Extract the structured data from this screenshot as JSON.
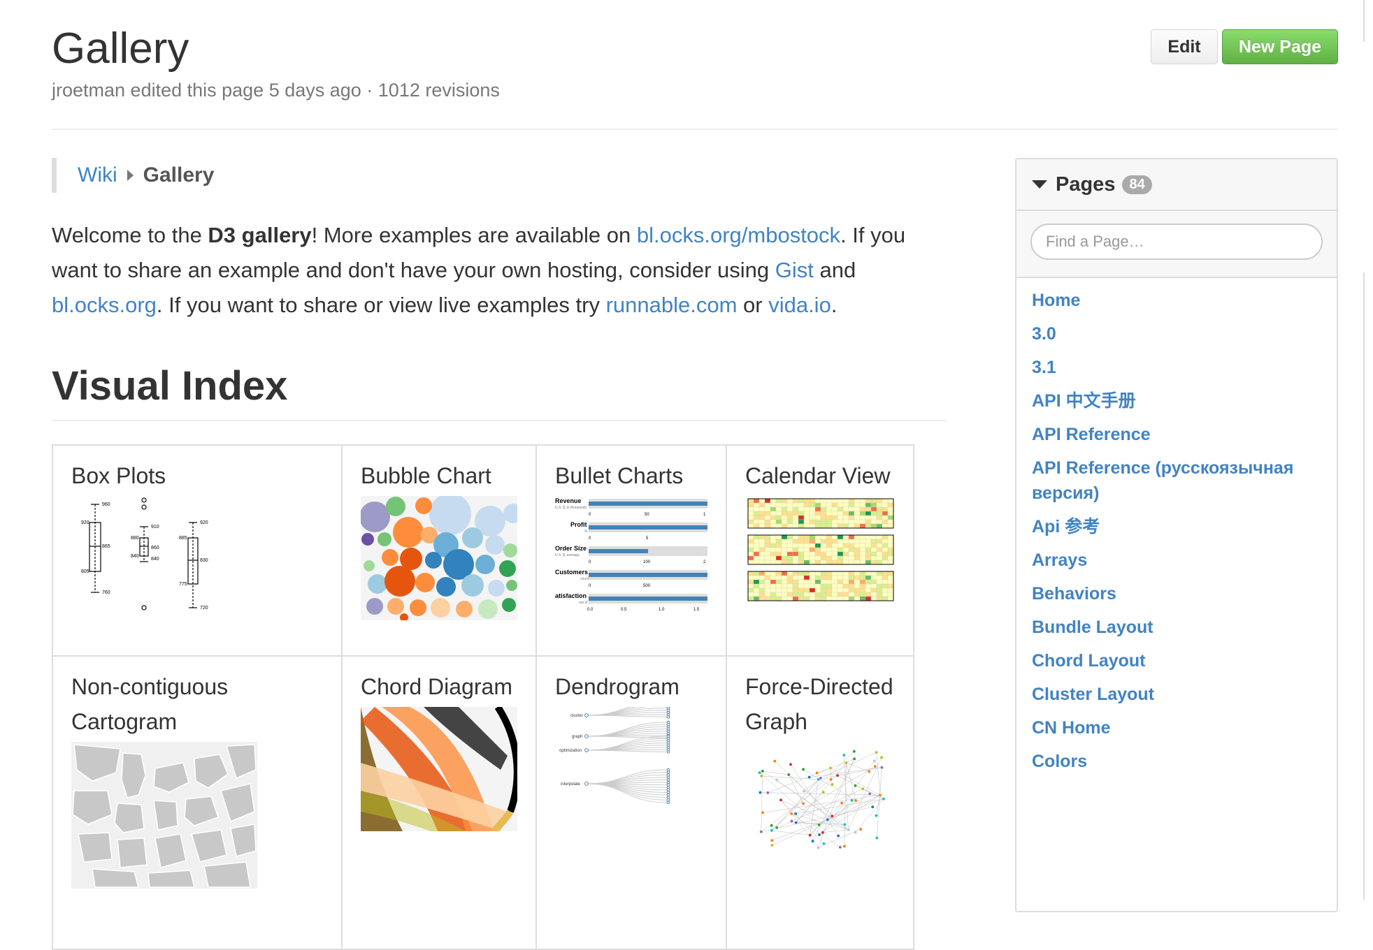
{
  "header": {
    "title": "Gallery",
    "meta": "jroetman edited this page 5 days ago · 1012 revisions",
    "edit_label": "Edit",
    "new_page_label": "New Page"
  },
  "breadcrumb": {
    "root": "Wiki",
    "current": "Gallery"
  },
  "intro": {
    "t1": "Welcome to the ",
    "bold": "D3 gallery",
    "t2": "! More examples are available on ",
    "link1": "bl.ocks.org/mbostock",
    "t3": ". If you want to share an example and don't have your own hosting, consider using ",
    "link2": "Gist",
    "t4": " and ",
    "link3": "bl.ocks.org",
    "t5": ". If you want to share or view live examples try ",
    "link4": "runnable.com",
    "t6": " or ",
    "link5": "vida.io",
    "t7": "."
  },
  "section": {
    "title": "Visual Index"
  },
  "gallery": {
    "row1": [
      {
        "title": "Box Plots"
      },
      {
        "title": "Bubble Chart"
      },
      {
        "title": "Bullet Charts"
      },
      {
        "title": "Calendar View"
      }
    ],
    "row2": [
      {
        "title_line1": "Non-contiguous",
        "title_line2": "Cartogram"
      },
      {
        "title": "Chord Diagram"
      },
      {
        "title": "Dendrogram"
      },
      {
        "title_line1": "Force-Directed",
        "title_line2": "Graph"
      }
    ],
    "thumb_text": {
      "box": [
        "960",
        "920",
        "865",
        "805",
        "760",
        "910",
        "880",
        "860",
        "840",
        "840",
        "885",
        "920",
        "830",
        "775",
        "720"
      ],
      "bullet_labels": [
        "Revenue",
        "Profit",
        "Order Size",
        "Customers",
        "atisfaction"
      ],
      "bullet_sublabels": [
        "U.S. $, in thousands",
        "%",
        "U.S. $, average",
        "count",
        "out of 5"
      ],
      "bullet_ticks": [
        "0",
        "50",
        "1",
        "0",
        "5",
        "0",
        "100",
        "2",
        "0",
        "500",
        "0.0",
        "0.5",
        "1.0",
        "1.5"
      ],
      "dendro_labels": [
        "cluster",
        "graph",
        "optimization",
        "interpolate"
      ]
    }
  },
  "sidebar": {
    "title": "Pages",
    "count": "84",
    "search_placeholder": "Find a Page…",
    "pages": [
      "Home",
      "3.0",
      "3.1",
      "API 中文手册",
      "API Reference",
      "API Reference (русскоязычная",
      "версия)",
      "Api 参考",
      "Arrays",
      "Behaviors",
      "Bundle Layout",
      "Chord Layout",
      "Cluster Layout",
      "CN Home",
      "Colors"
    ]
  },
  "colors": {
    "link": "#4183c4",
    "new_page_button": "#6cc644",
    "text": "#333333",
    "muted": "#777777",
    "border": "#dddddd"
  }
}
